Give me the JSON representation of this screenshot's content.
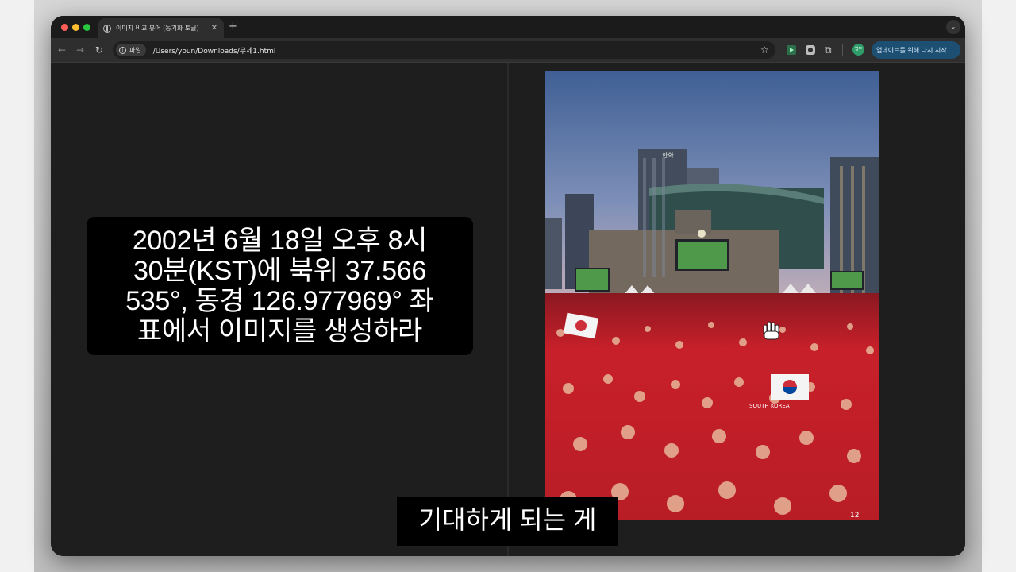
{
  "tab": {
    "title": "이미지 비교 뷰어 (동기화 토글)",
    "close_icon": "close-icon",
    "new_tab_label": "+"
  },
  "toolbar": {
    "back_glyph": "←",
    "forward_glyph": "→",
    "reload_glyph": "↻",
    "site_chip_label": "파일",
    "url": "/Users/youn/Downloads/무제1.html",
    "bookmark_glyph": "☆",
    "extensions_glyph": "⧉",
    "profile_label": "업무",
    "update_button_label": "업데이트를 위해 다시 시작",
    "update_menu_glyph": "⋮"
  },
  "tab_menu_glyph": "⌄",
  "prompt": {
    "lines": [
      "2002년 6월 18일 오후 8시",
      "30분(KST)에 북위 37.566",
      "535°, 동경 126.977969° 좌",
      "표에서 이미지를 생성하라"
    ]
  },
  "photo": {
    "building_sign": "한화",
    "scarf_text": "SOUTH KOREA",
    "jersey_number": "12"
  },
  "subtitle": "기대하게 되는 게",
  "colors": {
    "update_button_bg": "#1d4f73",
    "crowd_red": "#c8202a",
    "sky_top": "#3f5f94",
    "sky_bottom": "#c7b0b8"
  }
}
